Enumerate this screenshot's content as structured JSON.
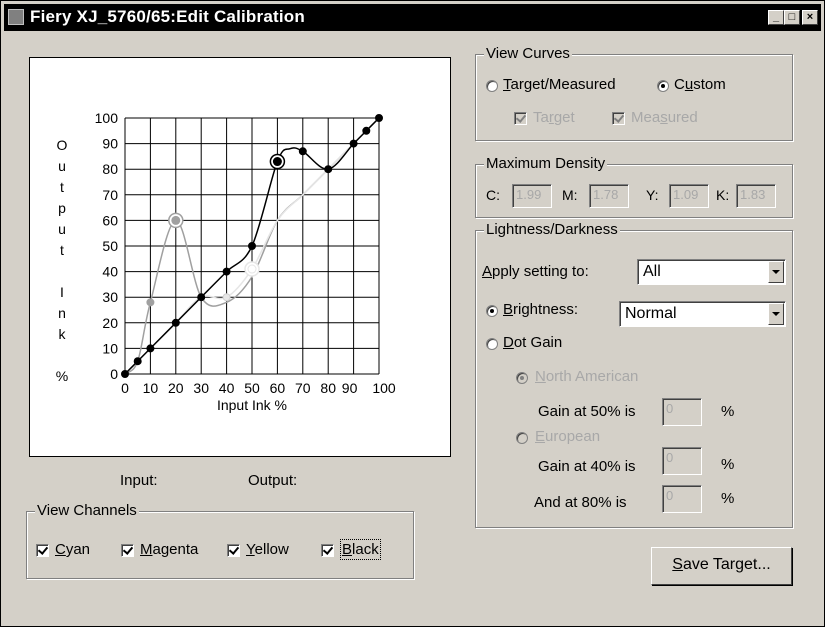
{
  "window": {
    "title": "Fiery XJ_5760/65:Edit Calibration",
    "controls": {
      "minimize": "_",
      "maximize": "□",
      "close": "×"
    }
  },
  "chart_data": {
    "type": "line",
    "xlabel": "Input Ink %",
    "ylabel": "Output Ink %",
    "xlim": [
      0,
      100
    ],
    "ylim": [
      0,
      100
    ],
    "x_ticks": [
      "0",
      "10",
      "20",
      "30",
      "40",
      "50",
      "60",
      "70",
      "80",
      "90",
      "100"
    ],
    "y_ticks": [
      "0",
      "10",
      "20",
      "30",
      "40",
      "50",
      "60",
      "70",
      "80",
      "90",
      "100"
    ],
    "grid": true,
    "series": [
      {
        "color": "#a0a0a0",
        "points": [
          [
            0,
            0
          ],
          [
            5,
            5
          ],
          [
            10,
            28
          ],
          [
            20,
            60
          ],
          [
            30,
            30
          ],
          [
            40,
            28
          ],
          [
            50,
            38
          ],
          [
            60,
            60
          ],
          [
            70,
            70
          ],
          [
            80,
            80
          ],
          [
            90,
            90
          ],
          [
            95,
            95
          ],
          [
            100,
            100
          ]
        ],
        "markers": [
          [
            10,
            28
          ],
          [
            20,
            60
          ]
        ],
        "selected_x": 20
      },
      {
        "color": "#e6e6e6",
        "points": [
          [
            0,
            0
          ],
          [
            5,
            5
          ],
          [
            10,
            10
          ],
          [
            20,
            20
          ],
          [
            30,
            30
          ],
          [
            40,
            30
          ],
          [
            50,
            41
          ],
          [
            60,
            60
          ],
          [
            70,
            70
          ],
          [
            80,
            80
          ],
          [
            90,
            90
          ],
          [
            95,
            95
          ],
          [
            100,
            100
          ]
        ],
        "markers": [
          [
            40,
            30
          ],
          [
            50,
            41
          ]
        ],
        "selected_x": 50
      },
      {
        "color": "#000000",
        "points": [
          [
            0,
            0
          ],
          [
            5,
            5
          ],
          [
            10,
            10
          ],
          [
            20,
            20
          ],
          [
            30,
            30
          ],
          [
            40,
            40
          ],
          [
            50,
            50
          ],
          [
            60,
            83
          ],
          [
            65,
            88
          ],
          [
            70,
            87
          ],
          [
            80,
            80
          ],
          [
            90,
            90
          ],
          [
            95,
            95
          ],
          [
            100,
            100
          ]
        ],
        "markers": [
          [
            0,
            0
          ],
          [
            5,
            5
          ],
          [
            10,
            10
          ],
          [
            20,
            20
          ],
          [
            30,
            30
          ],
          [
            40,
            40
          ],
          [
            50,
            50
          ],
          [
            60,
            83
          ],
          [
            70,
            87
          ],
          [
            80,
            80
          ],
          [
            90,
            90
          ],
          [
            95,
            95
          ],
          [
            100,
            100
          ]
        ],
        "selected_x": 60
      }
    ]
  },
  "chart_ylabel_letters": [
    "O",
    "u",
    "t",
    "p",
    "u",
    "t",
    "",
    "I",
    "n",
    "k",
    "",
    "%"
  ],
  "readout": {
    "input_label": "Input:",
    "output_label": "Output:"
  },
  "view_channels": {
    "title": "View Channels",
    "items": [
      {
        "label": "Cyan",
        "mnemonic": "C",
        "checked": true
      },
      {
        "label": "Magenta",
        "mnemonic": "M",
        "checked": true
      },
      {
        "label": "Yellow",
        "mnemonic": "Y",
        "checked": true
      },
      {
        "label": "Black",
        "mnemonic": "B",
        "checked": true
      }
    ]
  },
  "view_curves": {
    "title": "View Curves",
    "target_measured_label": "Target/Measured",
    "custom_label": "Custom",
    "selected": "custom",
    "target_label": "Target",
    "measured_label": "Measured"
  },
  "max_density": {
    "title": "Maximum Density",
    "c_label": "C:",
    "c_value": "1.99",
    "m_label": "M:",
    "m_value": "1.78",
    "y_label": "Y:",
    "y_value": "1.09",
    "k_label": "K:",
    "k_value": "1.83"
  },
  "lightness": {
    "title": "Lightness/Darkness",
    "apply_label": "Apply setting to:",
    "apply_value": "All",
    "brightness_label": "Brightness:",
    "brightness_value": "Normal",
    "dotgain_label": "Dot Gain",
    "selected": "brightness",
    "north_american_label": "North American",
    "gain50_label": "Gain at 50% is",
    "gain50_value": "0",
    "european_label": "European",
    "gain40_label": "Gain at 40% is",
    "gain40_value": "0",
    "gain80_label": "And at 80% is",
    "gain80_value": "0",
    "percent": "%"
  },
  "save_button": "Save Target..."
}
